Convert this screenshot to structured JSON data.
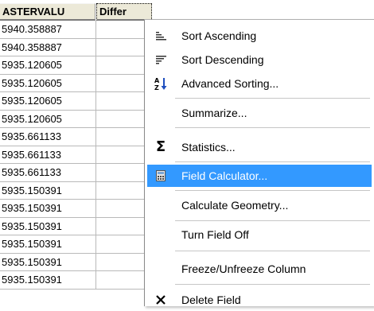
{
  "grid": {
    "columns": [
      "ASTERVALU",
      "Differ"
    ],
    "values": [
      "5940.358887",
      "5940.358887",
      "5935.120605",
      "5935.120605",
      "5935.120605",
      "5935.120605",
      "5935.661133",
      "5935.661133",
      "5935.661133",
      "5935.150391",
      "5935.150391",
      "5935.150391",
      "5935.150391",
      "5935.150391",
      "5935.150391"
    ]
  },
  "context_menu": {
    "items": [
      {
        "label": "Sort Ascending",
        "icon": "sort-ascending-icon"
      },
      {
        "label": "Sort Descending",
        "icon": "sort-descending-icon"
      },
      {
        "label": "Advanced Sorting...",
        "icon": "advanced-sort-icon"
      },
      {
        "label": "Summarize...",
        "icon": ""
      },
      {
        "label": "Statistics...",
        "icon": "sigma-icon"
      },
      {
        "label": "Field Calculator...",
        "icon": "calculator-icon",
        "highlighted": true
      },
      {
        "label": "Calculate Geometry...",
        "icon": ""
      },
      {
        "label": "Turn Field Off",
        "icon": ""
      },
      {
        "label": "Freeze/Unfreeze Column",
        "icon": ""
      },
      {
        "label": "Delete Field",
        "icon": "delete-x-icon"
      }
    ],
    "highlight_color": "#3399ff"
  }
}
